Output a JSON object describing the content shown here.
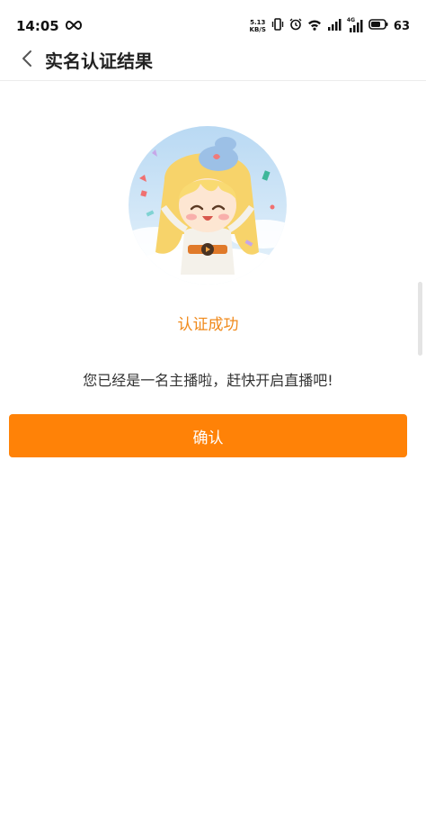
{
  "status_bar": {
    "time": "14:05",
    "net_speed_value": "5.13",
    "net_speed_unit": "KB/S",
    "battery_level": "63",
    "lte_label": "4G"
  },
  "header": {
    "title": "实名认证结果"
  },
  "result": {
    "status_text": "认证成功",
    "description": "您已经是一名主播啦，赶快开启直播吧!"
  },
  "actions": {
    "confirm_label": "确认"
  },
  "colors": {
    "accent": "#ff8207",
    "success_text": "#f08a1c"
  }
}
